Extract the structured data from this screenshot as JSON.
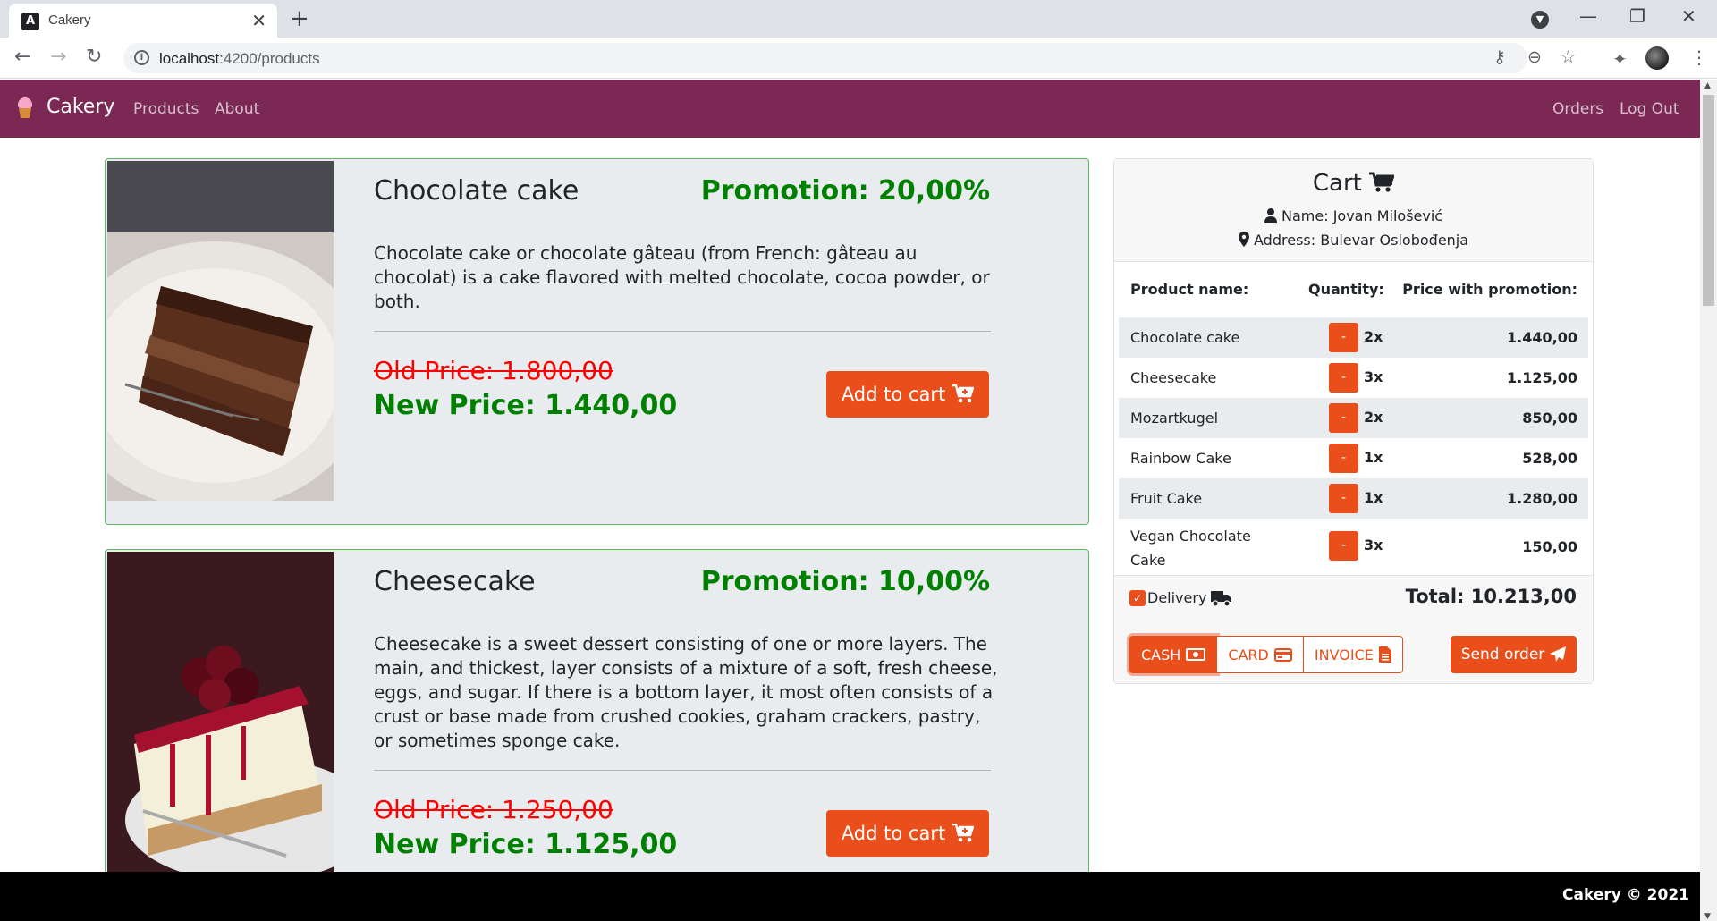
{
  "browser": {
    "tab_title": "Cakery",
    "tab_favicon": "A",
    "tab_close": "✕",
    "new_tab": "+",
    "url_host": "localhost",
    "url_path": ":4200/products",
    "win_minimize": "—",
    "win_restore": "❐",
    "win_close": "✕",
    "nav_back": "←",
    "nav_forward": "→",
    "nav_reload": "↻",
    "icons": [
      "key-icon",
      "zoom-icon",
      "star-icon",
      "extensions-icon",
      "profile-avatar",
      "menu-icon"
    ],
    "key_glyph": "⚷",
    "zoom_glyph": "⊖",
    "star_glyph": "☆",
    "ext_glyph": "✦",
    "kebab_glyph": "⋮",
    "dropdown_glyph": "▼"
  },
  "navbar": {
    "brand": "Cakery",
    "links": {
      "products": "Products",
      "about": "About",
      "orders": "Orders",
      "logout": "Log Out"
    },
    "bg_color": "#7b2855"
  },
  "products": [
    {
      "name": "Chocolate cake",
      "promotion": "Promotion: 20,00%",
      "description": "Chocolate cake or chocolate gâteau (from French: gâteau au chocolat) is a cake flavored with melted chocolate, cocoa powder, or both.",
      "old_price": "Old Price: 1.800,00",
      "new_price": "New Price: 1.440,00",
      "button": "Add to cart"
    },
    {
      "name": "Cheesecake",
      "promotion": "Promotion: 10,00%",
      "description": "Cheesecake is a sweet dessert consisting of one or more layers. The main, and thickest, layer consists of a mixture of a soft, fresh cheese, eggs, and sugar. If there is a bottom layer, it most often consists of a crust or base made from crushed cookies, graham crackers, pastry, or sometimes sponge cake.",
      "old_price": "Old Price: 1.250,00",
      "new_price": "New Price: 1.125,00",
      "button": "Add to cart"
    }
  ],
  "cart": {
    "title": "Cart",
    "name": "Name: Jovan Milošević",
    "address": "Address: Bulevar Oslobođenja",
    "headers": {
      "product": "Product name:",
      "quantity": "Quantity:",
      "price": "Price with promotion:"
    },
    "minus_label": "-",
    "items": [
      {
        "name": "Chocolate cake",
        "qty": "2x",
        "price": "1.440,00"
      },
      {
        "name": "Cheesecake",
        "qty": "3x",
        "price": "1.125,00"
      },
      {
        "name": "Mozartkugel",
        "qty": "2x",
        "price": "850,00"
      },
      {
        "name": "Rainbow Cake",
        "qty": "1x",
        "price": "528,00"
      },
      {
        "name": "Fruit Cake",
        "qty": "1x",
        "price": "1.280,00"
      },
      {
        "name": "Vegan Chocolate Cake",
        "qty": "3x",
        "price": "150,00"
      }
    ],
    "delivery_label": "Delivery",
    "delivery_checked": true,
    "check_glyph": "✓",
    "total": "Total: 10.213,00",
    "payment": {
      "cash": "CASH",
      "card": "CARD",
      "invoice": "INVOICE",
      "selected": "cash"
    },
    "send": "Send order",
    "accent_color": "#e94e1b"
  },
  "footer": {
    "text": "Cakery © 2021"
  }
}
